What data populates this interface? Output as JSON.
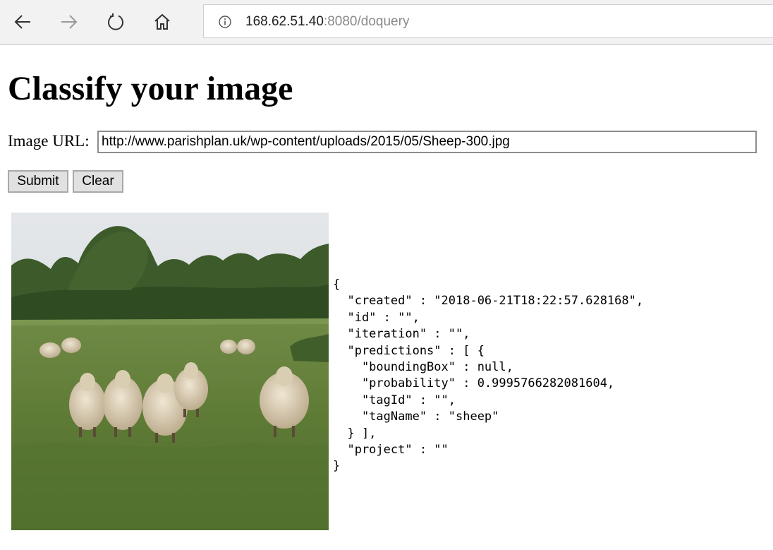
{
  "browser": {
    "url_host": "168.62.51.40",
    "url_rest": ":8080/doquery",
    "icons": [
      "back-arrow-icon",
      "forward-arrow-icon",
      "refresh-icon",
      "home-icon",
      "info-icon"
    ]
  },
  "page": {
    "title": "Classify your image",
    "url_label": "Image URL:",
    "url_value": "http://www.parishplan.uk/wp-content/uploads/2015/05/Sheep-300.jpg",
    "submit_label": "Submit",
    "clear_label": "Clear",
    "result_text": "{\n  \"created\" : \"2018-06-21T18:22:57.628168\",\n  \"id\" : \"\",\n  \"iteration\" : \"\",\n  \"predictions\" : [ {\n    \"boundingBox\" : null,\n    \"probability\" : 0.9995766282081604,\n    \"tagId\" : \"\",\n    \"tagName\" : \"sheep\"\n  } ],\n  \"project\" : \"\"\n}"
  }
}
